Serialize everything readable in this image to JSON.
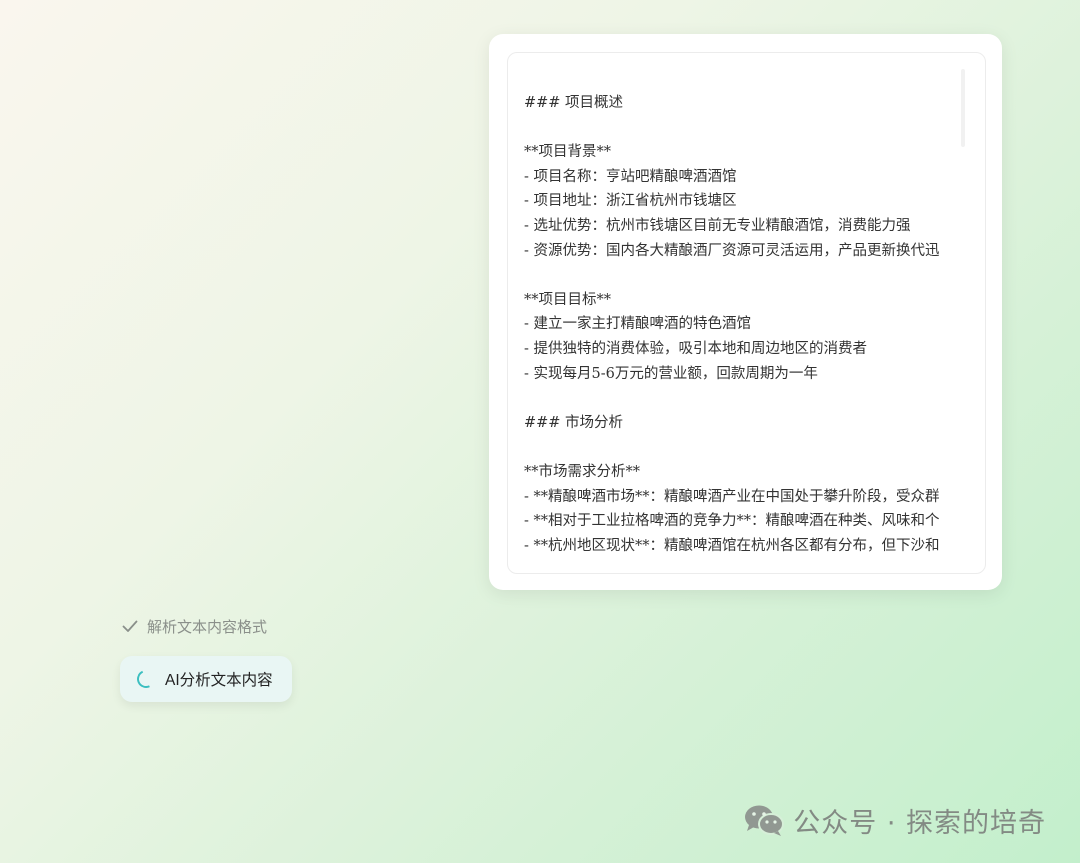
{
  "document": {
    "lines": [
      "### 项目概述",
      "",
      "**项目背景**",
      "- 项目名称：亨站吧精酿啤酒酒馆",
      "- 项目地址：浙江省杭州市钱塘区",
      "- 选址优势：杭州市钱塘区目前无专业精酿酒馆，消费能力强",
      "- 资源优势：国内各大精酿酒厂资源可灵活运用，产品更新换代迅",
      "",
      "**项目目标**",
      "- 建立一家主打精酿啤酒的特色酒馆",
      "- 提供独特的消费体验，吸引本地和周边地区的消费者",
      "- 实现每月5-6万元的营业额，回款周期为一年",
      "",
      "### 市场分析",
      "",
      "**市场需求分析**",
      "- **精酿啤酒市场**：精酿啤酒产业在中国处于攀升阶段，受众群",
      "- **相对于工业拉格啤酒的竞争力**：精酿啤酒在种类、风味和个",
      "- **杭州地区现状**：精酿啤酒馆在杭州各区都有分布，但下沙和"
    ]
  },
  "steps": {
    "done_label": "解析文本内容格式",
    "active_label": "AI分析文本内容"
  },
  "watermark": {
    "text": "公众号 · 探索的培奇"
  },
  "colors": {
    "accent": "#3cbfc0",
    "done_text": "#8a8f8a"
  }
}
